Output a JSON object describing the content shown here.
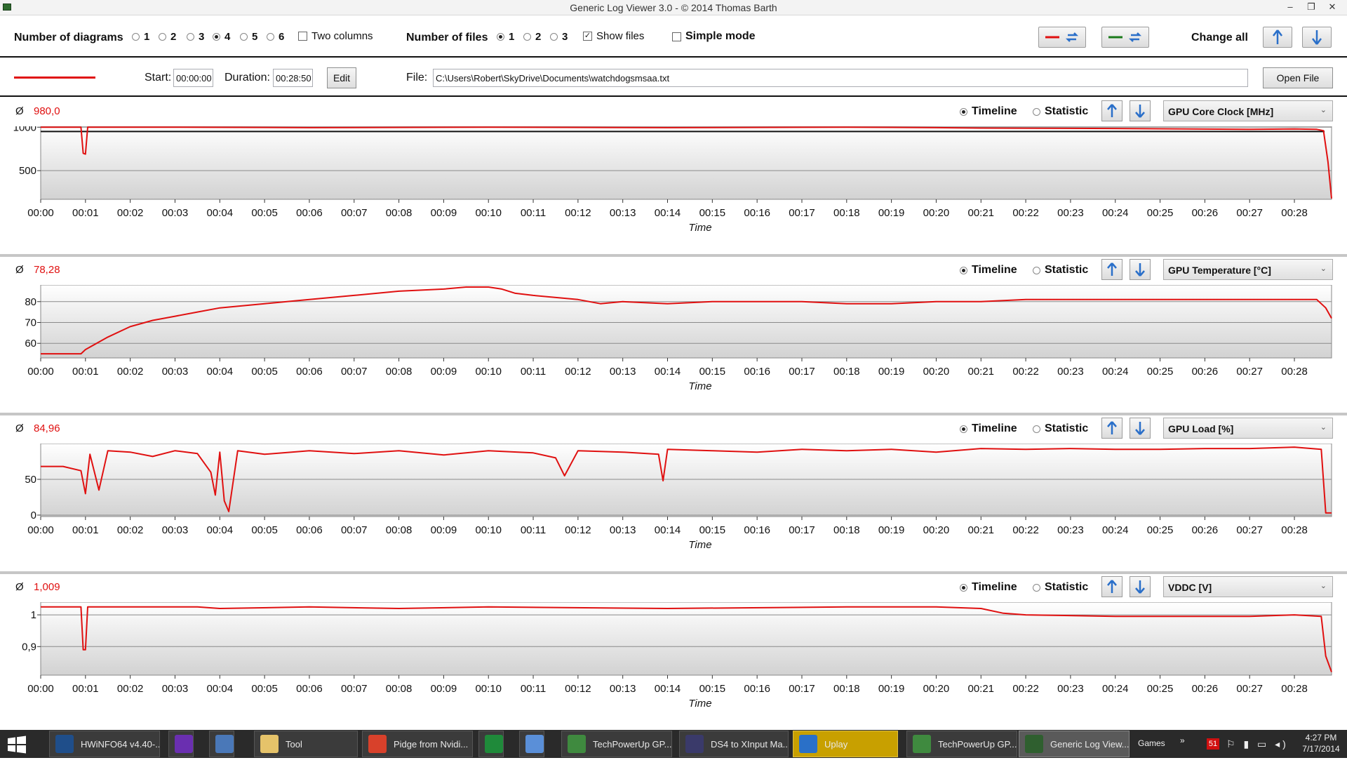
{
  "window": {
    "title": "Generic Log Viewer 3.0 - © 2014 Thomas Barth",
    "minimize": "–",
    "restore": "❐",
    "close": "✕"
  },
  "toolbar": {
    "num_diagrams_label": "Number of diagrams",
    "diagram_options": [
      "1",
      "2",
      "3",
      "4",
      "5",
      "6"
    ],
    "diagram_selected": "4",
    "two_columns_label": "Two columns",
    "num_files_label": "Number of files",
    "file_options": [
      "1",
      "2",
      "3"
    ],
    "file_selected": "1",
    "show_files_label": "Show files",
    "show_files_checked": true,
    "simple_mode_label": "Simple mode",
    "simple_mode_checked": false,
    "change_all_label": "Change all"
  },
  "fileinfo": {
    "start_label": "Start:",
    "start_value": "00:00:00",
    "duration_label": "Duration:",
    "duration_value": "00:28:50",
    "edit_label": "Edit",
    "file_label": "File:",
    "file_path": "C:\\Users\\Robert\\SkyDrive\\Documents\\watchdogsmsaa.txt",
    "open_label": "Open File",
    "line_color": "#e01010"
  },
  "panel_controls": {
    "avg_symbol": "Ø",
    "timeline_label": "Timeline",
    "statistic_label": "Statistic",
    "mode_selected": "Timeline"
  },
  "panels": [
    {
      "avg": "980,0",
      "sensor": "GPU Core Clock [MHz]"
    },
    {
      "avg": "78,28",
      "sensor": "GPU Temperature [°C]"
    },
    {
      "avg": "84,96",
      "sensor": "GPU Load [%]"
    },
    {
      "avg": "1,009",
      "sensor": "VDDC [V]"
    }
  ],
  "chart_data": [
    {
      "type": "line",
      "xlabel": "Time",
      "x_ticks": [
        "00:00",
        "00:01",
        "00:02",
        "00:03",
        "00:04",
        "00:05",
        "00:06",
        "00:07",
        "00:08",
        "00:09",
        "00:10",
        "00:11",
        "00:12",
        "00:13",
        "00:14",
        "00:15",
        "00:16",
        "00:17",
        "00:18",
        "00:19",
        "00:20",
        "00:21",
        "00:22",
        "00:23",
        "00:24",
        "00:25",
        "00:26",
        "00:27",
        "00:28"
      ],
      "y_ticks": [
        "500",
        "1000"
      ],
      "ylim": [
        170,
        1010
      ],
      "xlim": [
        0,
        28.83
      ],
      "average_line": 950,
      "series": [
        {
          "x": [
            0,
            0.9,
            0.95,
            1.0,
            1.05,
            3,
            6,
            10,
            14,
            18,
            20,
            21,
            24,
            27,
            28,
            28.5,
            28.65,
            28.75,
            28.83
          ],
          "y": [
            1000,
            1000,
            700,
            690,
            1000,
            1000,
            995,
            1000,
            995,
            1000,
            995,
            990,
            985,
            975,
            980,
            975,
            960,
            600,
            180
          ]
        }
      ]
    },
    {
      "type": "line",
      "xlabel": "Time",
      "x_ticks": [
        "00:00",
        "00:01",
        "00:02",
        "00:03",
        "00:04",
        "00:05",
        "00:06",
        "00:07",
        "00:08",
        "00:09",
        "00:10",
        "00:11",
        "00:12",
        "00:13",
        "00:14",
        "00:15",
        "00:16",
        "00:17",
        "00:18",
        "00:19",
        "00:20",
        "00:21",
        "00:22",
        "00:23",
        "00:24",
        "00:25",
        "00:26",
        "00:27",
        "00:28"
      ],
      "y_ticks": [
        "60",
        "70",
        "80"
      ],
      "ylim": [
        53,
        88
      ],
      "xlim": [
        0,
        28.83
      ],
      "series": [
        {
          "x": [
            0,
            0.3,
            0.6,
            0.9,
            1.0,
            1.5,
            2,
            2.5,
            3,
            3.5,
            4,
            4.5,
            5,
            6,
            7,
            8,
            9,
            9.5,
            10,
            10.3,
            10.6,
            11,
            12,
            12.5,
            13,
            14,
            15,
            16,
            17,
            18,
            19,
            20,
            21,
            22,
            23,
            24,
            25,
            26,
            27,
            28,
            28.5,
            28.7,
            28.83
          ],
          "y": [
            55,
            55,
            55,
            55,
            57,
            63,
            68,
            71,
            73,
            75,
            77,
            78,
            79,
            81,
            83,
            85,
            86,
            87,
            87,
            86,
            84,
            83,
            81,
            79,
            80,
            79,
            80,
            80,
            80,
            79,
            79,
            80,
            80,
            81,
            81,
            81,
            81,
            81,
            81,
            81,
            81,
            77,
            72
          ]
        }
      ]
    },
    {
      "type": "line",
      "xlabel": "Time",
      "x_ticks": [
        "00:00",
        "00:01",
        "00:02",
        "00:03",
        "00:04",
        "00:05",
        "00:06",
        "00:07",
        "00:08",
        "00:09",
        "00:10",
        "00:11",
        "00:12",
        "00:13",
        "00:14",
        "00:15",
        "00:16",
        "00:17",
        "00:18",
        "00:19",
        "00:20",
        "00:21",
        "00:22",
        "00:23",
        "00:24",
        "00:25",
        "00:26",
        "00:27",
        "00:28"
      ],
      "y_ticks": [
        "0",
        "50"
      ],
      "ylim": [
        -2,
        100
      ],
      "xlim": [
        0,
        28.83
      ],
      "series": [
        {
          "x": [
            0,
            0.5,
            0.9,
            1.0,
            1.1,
            1.3,
            1.5,
            2,
            2.5,
            3,
            3.5,
            3.8,
            3.9,
            4.0,
            4.1,
            4.2,
            4.4,
            5,
            6,
            7,
            8,
            9,
            10,
            11,
            11.5,
            11.7,
            12,
            13,
            13.8,
            13.9,
            14,
            15,
            16,
            17,
            18,
            19,
            20,
            21,
            22,
            23,
            24,
            25,
            26,
            27,
            28,
            28.6,
            28.7,
            28.83
          ],
          "y": [
            68,
            68,
            62,
            30,
            85,
            35,
            90,
            88,
            82,
            90,
            86,
            60,
            28,
            88,
            20,
            5,
            90,
            85,
            90,
            86,
            90,
            84,
            90,
            87,
            80,
            55,
            90,
            88,
            85,
            48,
            92,
            90,
            88,
            92,
            90,
            92,
            88,
            93,
            92,
            93,
            92,
            92,
            93,
            93,
            95,
            92,
            3,
            3
          ]
        }
      ]
    },
    {
      "type": "line",
      "xlabel": "Time",
      "x_ticks": [
        "00:00",
        "00:01",
        "00:02",
        "00:03",
        "00:04",
        "00:05",
        "00:06",
        "00:07",
        "00:08",
        "00:09",
        "00:10",
        "00:11",
        "00:12",
        "00:13",
        "00:14",
        "00:15",
        "00:16",
        "00:17",
        "00:18",
        "00:19",
        "00:20",
        "00:21",
        "00:22",
        "00:23",
        "00:24",
        "00:25",
        "00:26",
        "00:27",
        "00:28"
      ],
      "y_ticks": [
        "0,9",
        "1"
      ],
      "ylim": [
        0.81,
        1.04
      ],
      "xlim": [
        0,
        28.83
      ],
      "series": [
        {
          "x": [
            0,
            0.9,
            0.95,
            1.0,
            1.05,
            3.5,
            4,
            6,
            8,
            10,
            14,
            18,
            20,
            21,
            21.5,
            22,
            24,
            26,
            27,
            28,
            28.6,
            28.7,
            28.83
          ],
          "y": [
            1.025,
            1.025,
            0.89,
            0.89,
            1.025,
            1.025,
            1.02,
            1.025,
            1.02,
            1.025,
            1.02,
            1.025,
            1.025,
            1.02,
            1.005,
            1.0,
            0.995,
            0.995,
            0.995,
            1.0,
            0.995,
            0.87,
            0.82
          ]
        }
      ]
    }
  ],
  "taskbar": {
    "items": [
      {
        "label": "HWiNFO64 v4.40-...",
        "icon": "hwinfo-icon"
      },
      {
        "label": "",
        "icon": "flag-icon"
      },
      {
        "label": "",
        "icon": "calculator-icon"
      },
      {
        "label": "Tool",
        "icon": "folder-icon"
      },
      {
        "label": "Pidge from Nvidi...",
        "icon": "chrome-icon"
      },
      {
        "label": "",
        "icon": "store-icon"
      },
      {
        "label": "",
        "icon": "paint-icon"
      },
      {
        "label": "TechPowerUp GP...",
        "icon": "gpuz-icon"
      },
      {
        "label": "DS4 to XInput Ma...",
        "icon": "ds4-icon"
      },
      {
        "label": "Uplay",
        "icon": "uplay-icon"
      },
      {
        "label": "TechPowerUp GP...",
        "icon": "gpuz-icon"
      },
      {
        "label": "Generic Log View...",
        "icon": "logviewer-icon"
      }
    ],
    "games_label": "Games",
    "games_chevron": "»",
    "badge": "51",
    "time": "4:27 PM",
    "date": "7/17/2014"
  },
  "colors": {
    "series": "#e01010",
    "accent_blue": "#3a7bd5",
    "green_line": "#1a7a1a"
  }
}
